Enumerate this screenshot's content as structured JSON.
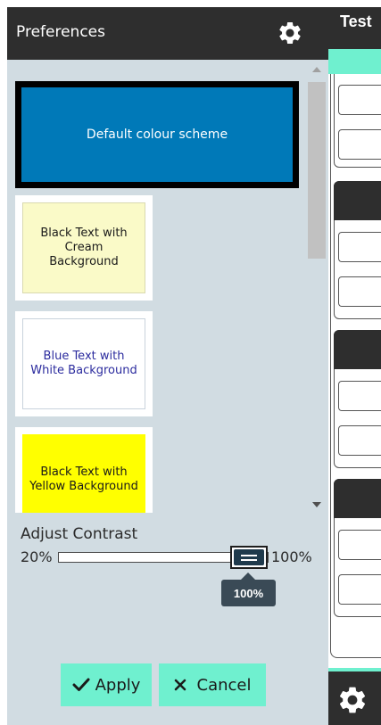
{
  "preferences": {
    "title": "Preferences",
    "header_icon": "gear-icon"
  },
  "schemes": [
    {
      "label": "Default colour scheme",
      "background": "#0079b8",
      "text_color": "#ffffff",
      "selected": true
    },
    {
      "label": "Black Text with Cream Background",
      "background": "#fafac8",
      "text_color": "#1a1a1a",
      "selected": false
    },
    {
      "label": "Blue Text with White Background",
      "background": "#ffffff",
      "text_color": "#2b2b9e",
      "selected": false
    },
    {
      "label": "Black Text with Yellow Background",
      "background": "#ffff00",
      "text_color": "#1a1a1a",
      "selected": false
    }
  ],
  "contrast": {
    "label": "Adjust Contrast",
    "min_label": "20%",
    "max_label": "100%",
    "value": 100,
    "tooltip": "100%"
  },
  "buttons": {
    "apply_label": "Apply",
    "apply_icon": "check-icon",
    "cancel_label": "Cancel",
    "cancel_icon": "close-icon"
  },
  "background_page": {
    "title": "Test",
    "footer_icon": "gear-icon"
  },
  "colors": {
    "accent": "#6ff0cf",
    "panel_bg": "#d1dce2",
    "header_bg": "#2e2e2e"
  }
}
